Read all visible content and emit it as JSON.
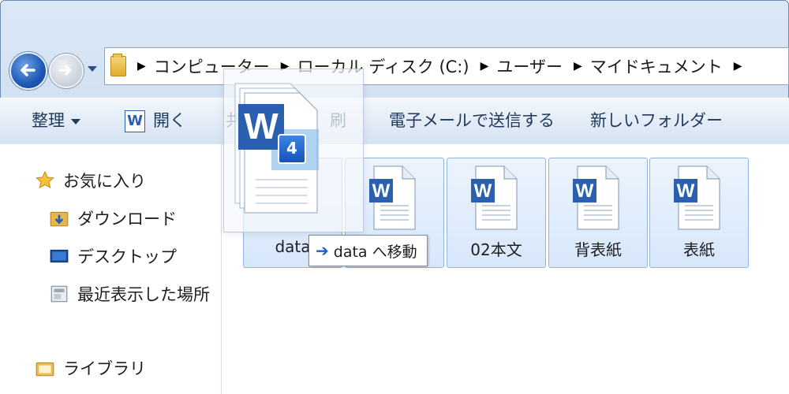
{
  "address": {
    "crumbs": [
      "コンピューター",
      "ローカル ディスク (C:)",
      "ユーザー",
      "マイドキュメント"
    ]
  },
  "toolbar": {
    "organize": "整理",
    "open": "開く",
    "share_partial": "共",
    "print_partial": "刷",
    "email": "電子メールで送信する",
    "new_folder": "新しいフォルダー"
  },
  "navpane": {
    "favorites": "お気に入り",
    "downloads": "ダウンロード",
    "desktop": "デスクトップ",
    "recent": "最近表示した場所",
    "libraries": "ライブラリ"
  },
  "files": [
    {
      "label": "data"
    },
    {
      "label": ""
    },
    {
      "label": "02本文"
    },
    {
      "label": "背表紙"
    },
    {
      "label": "表紙"
    }
  ],
  "drag": {
    "count": "4",
    "tooltip": "data へ移動"
  },
  "colors": {
    "accent": "#2b5fb0",
    "selection": "#d7e7fb",
    "toolbar_text": "#1e395b"
  }
}
